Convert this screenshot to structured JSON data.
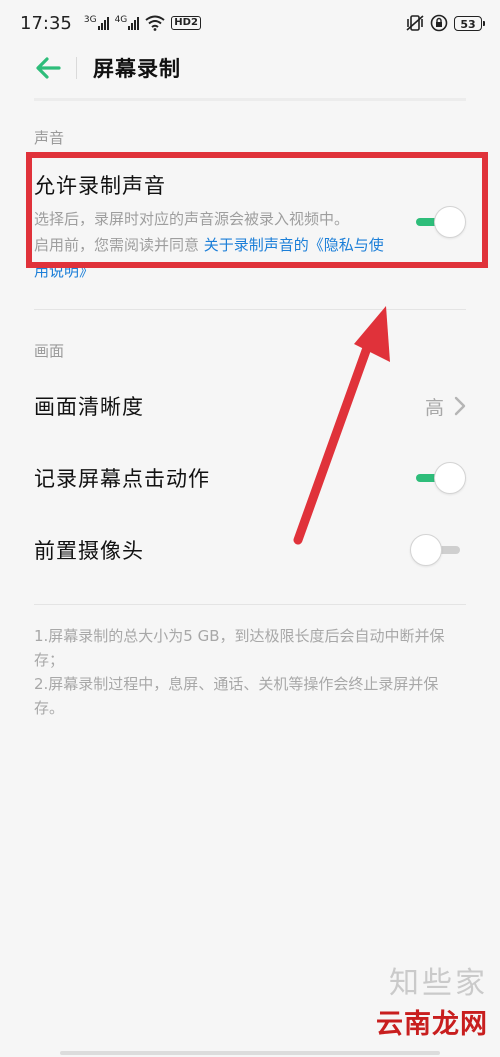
{
  "status_bar": {
    "time": "17:35",
    "net1": "3G",
    "net2": "4G",
    "hd": "HD2",
    "battery": "53"
  },
  "header": {
    "title": "屏幕录制"
  },
  "sound_section": {
    "label": "声音",
    "allow_record": {
      "title": "允许录制声音",
      "desc_line1": "选择后，录屏时对应的声音源会被录入视频中。",
      "desc_line2_prefix": "启用前，您需阅读并同意 ",
      "desc_link": "关于录制声音的《隐私与使用说明》",
      "enabled": true
    }
  },
  "picture_section": {
    "label": "画面",
    "clarity": {
      "title": "画面清晰度",
      "value": "高"
    },
    "record_taps": {
      "title": "记录屏幕点击动作",
      "enabled": true
    },
    "front_camera": {
      "title": "前置摄像头",
      "enabled": false
    }
  },
  "notes": {
    "line1": "1.屏幕录制的总大小为5 GB，到达极限长度后会自动中断并保存；",
    "line2": "2.屏幕录制过程中，息屏、通话、关机等操作会终止录屏并保存。"
  },
  "colors": {
    "accent": "#2ebd7a",
    "link": "#1c7fd8",
    "annotation": "#e0323a"
  },
  "watermark": {
    "top": "知些家",
    "bottom": "云南龙网"
  }
}
